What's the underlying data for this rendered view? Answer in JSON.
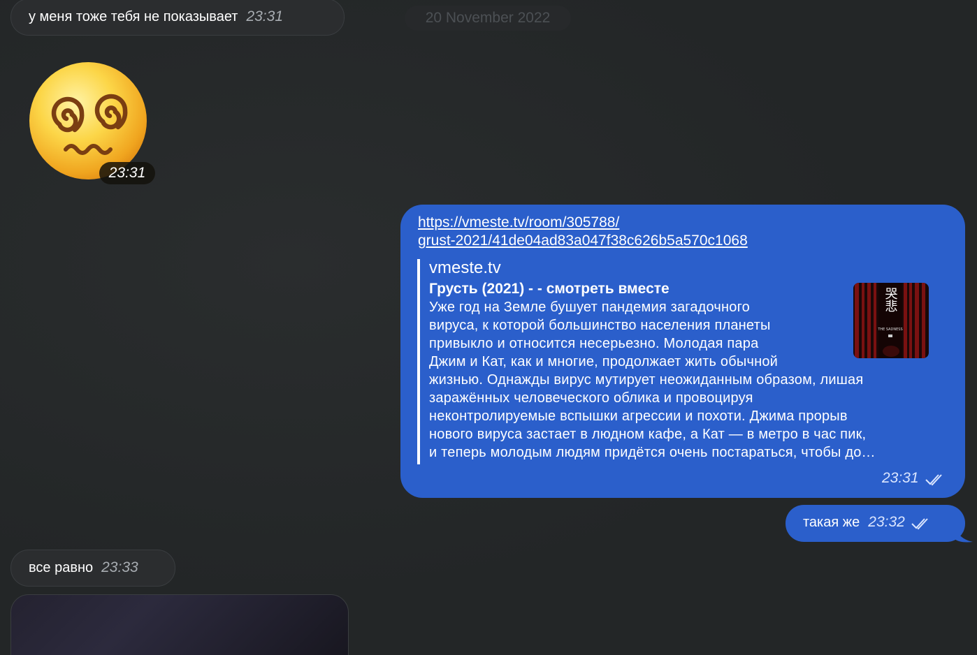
{
  "messages": {
    "in1": {
      "text": "у меня тоже тебя не показывает",
      "time": "23:31"
    },
    "sticker": {
      "icon": "dizzy-face-emoji",
      "time": "23:31"
    },
    "date_separator": "20 November 2022",
    "link_msg": {
      "url_line1": "https://vmeste.tv/room/305788/",
      "url_line2": "grust-2021/41de04ad83a047f38c626b5a570c1068",
      "preview": {
        "site": "vmeste.tv",
        "title": "Грусть (2021) -  - смотреть вместе",
        "desc_lines": [
          "Уже год на Земле бушует пандемия загадочного",
          "вируса, к которой большинство населения планеты",
          "привыкло и относится несерьезно. Молодая пара",
          "Джим и Кат, как и многие, продолжает жить обычной",
          "жизнью. Однажды вирус мутирует неожиданным образом, лишая",
          "заражённых человеческого облика и провоцируя",
          "неконтролируемые вспышки агрессии и похоти. Джима прорыв",
          "нового вируса застает в людном кафе, а Кат — в метро в час пик,",
          "и теперь молодым людям придётся очень постараться, чтобы до…"
        ],
        "thumb_text": "哭悲",
        "thumb_sub": "THE SADNESS"
      },
      "time": "23:31"
    },
    "out2": {
      "text": "такая же",
      "time": "23:32"
    },
    "in2": {
      "text": "все равно",
      "time": "23:33"
    }
  },
  "colors": {
    "background": "#232627",
    "incoming_bubble": "#2b2d2f",
    "outgoing_bubble": "#2b5fcb"
  }
}
